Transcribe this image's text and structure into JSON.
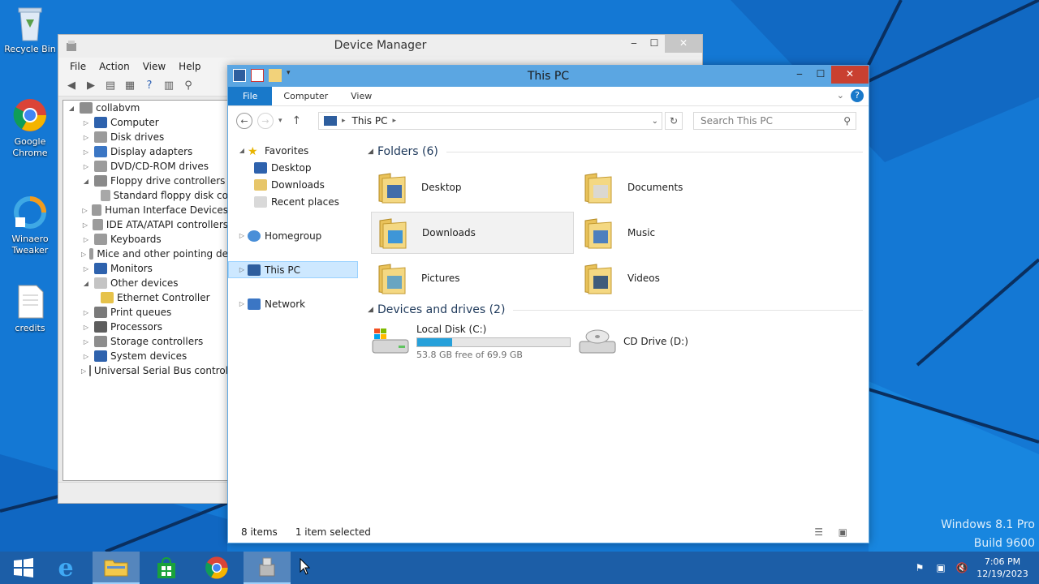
{
  "desktop": {
    "icons": [
      {
        "label": "Recycle Bin"
      },
      {
        "label": "Google Chrome"
      },
      {
        "label": "Winaero Tweaker"
      },
      {
        "label": "credits"
      }
    ],
    "watermark": {
      "line1": "Windows 8.1 Pro",
      "line2": "Build 9600"
    }
  },
  "device_manager": {
    "title": "Device Manager",
    "menu": [
      "File",
      "Action",
      "View",
      "Help"
    ],
    "tree": {
      "root": "collabvm",
      "items": [
        {
          "label": "Computer",
          "expanded": false,
          "level": 1
        },
        {
          "label": "Disk drives",
          "expanded": false,
          "level": 1
        },
        {
          "label": "Display adapters",
          "expanded": false,
          "level": 1
        },
        {
          "label": "DVD/CD-ROM drives",
          "expanded": false,
          "level": 1
        },
        {
          "label": "Floppy drive controllers",
          "expanded": true,
          "level": 1
        },
        {
          "label": "Standard floppy disk co",
          "level": 2
        },
        {
          "label": "Human Interface Devices",
          "expanded": false,
          "level": 1
        },
        {
          "label": "IDE ATA/ATAPI controllers",
          "expanded": false,
          "level": 1
        },
        {
          "label": "Keyboards",
          "expanded": false,
          "level": 1
        },
        {
          "label": "Mice and other pointing de",
          "expanded": false,
          "level": 1
        },
        {
          "label": "Monitors",
          "expanded": false,
          "level": 1
        },
        {
          "label": "Other devices",
          "expanded": true,
          "level": 1
        },
        {
          "label": "Ethernet Controller",
          "level": 2
        },
        {
          "label": "Print queues",
          "expanded": false,
          "level": 1
        },
        {
          "label": "Processors",
          "expanded": false,
          "level": 1
        },
        {
          "label": "Storage controllers",
          "expanded": false,
          "level": 1
        },
        {
          "label": "System devices",
          "expanded": false,
          "level": 1
        },
        {
          "label": "Universal Serial Bus control",
          "expanded": false,
          "level": 1
        }
      ]
    }
  },
  "explorer": {
    "title": "This PC",
    "ribbon_tabs": [
      "File",
      "Computer",
      "View"
    ],
    "address": "This PC",
    "search_placeholder": "Search This PC",
    "nav": {
      "favorites": "Favorites",
      "favorites_items": [
        "Desktop",
        "Downloads",
        "Recent places"
      ],
      "homegroup": "Homegroup",
      "this_pc": "This PC",
      "network": "Network"
    },
    "folders_header": "Folders (6)",
    "folders": [
      "Desktop",
      "Documents",
      "Downloads",
      "Music",
      "Pictures",
      "Videos"
    ],
    "selected_folder": "Downloads",
    "devices_header": "Devices and drives (2)",
    "drives": [
      {
        "name": "Local Disk (C:)",
        "free_text": "53.8 GB free of 69.9 GB",
        "used_fraction": 0.23
      },
      {
        "name": "CD Drive (D:)"
      }
    ],
    "status": {
      "items": "8 items",
      "selected": "1 item selected"
    }
  },
  "taskbar": {
    "clock_time": "7:06 PM",
    "clock_date": "12/19/2023"
  },
  "colors": {
    "accent": "#1979ca",
    "title_active": "#5ba6e2",
    "close_red": "#c94030",
    "taskbar": "#1c5ea7"
  }
}
